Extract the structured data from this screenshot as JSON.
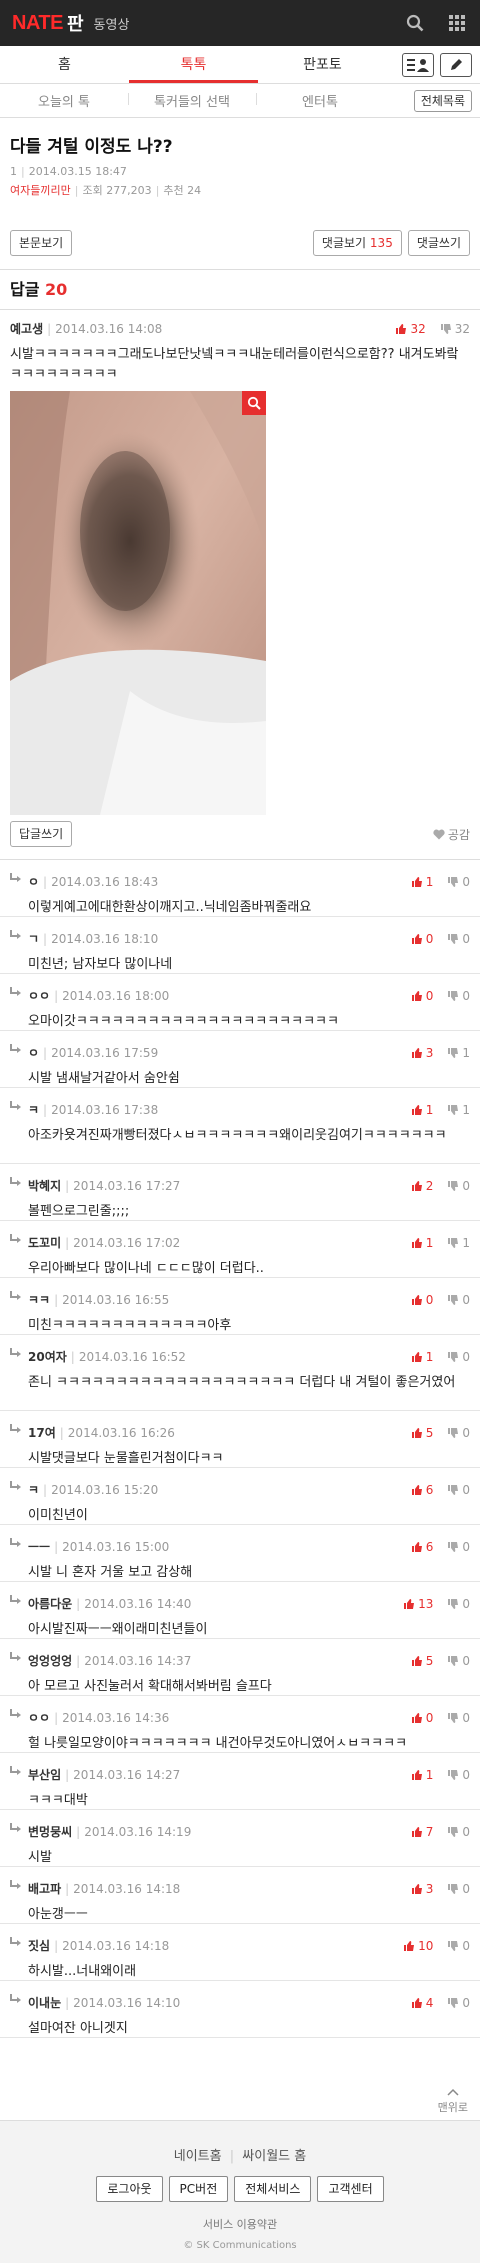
{
  "header": {
    "logo_nate": "NATE",
    "logo_pan": "판",
    "video_link": "동영상",
    "icons": [
      "search-icon",
      "grid-menu-icon"
    ]
  },
  "main_tabs": [
    {
      "label": "홈",
      "active": false
    },
    {
      "label": "톡톡",
      "active": true
    },
    {
      "label": "판포토",
      "active": false
    }
  ],
  "sub_tabs": [
    {
      "label": "오늘의 톡"
    },
    {
      "label": "톡커들의 선택"
    },
    {
      "label": "엔터톡"
    }
  ],
  "all_list_label": "전체목록",
  "post": {
    "title": "다들 겨털 이정도 나??",
    "number": "1",
    "date": "2014.03.15 18:47",
    "category": "여자들끼리만",
    "views": "조회 277,203",
    "recommend": "추천 24",
    "view_body_label": "본문보기",
    "view_comments_label": "댓글보기",
    "comments_count": "135",
    "write_comment_label": "댓글쓰기"
  },
  "reply_count": {
    "label": "답글",
    "count": "20"
  },
  "best_comment": {
    "name": "예고생",
    "date": "2014.03.16 14:08",
    "up": "32",
    "down": "32",
    "text": "시발ㅋㅋㅋㅋㅋㅋㅋ그래도나보단낫넼ㅋㅋㅋ내눈테러를이런식으로함?? 내겨도봐랔ㅋㅋㅋㅋㅋㅋㅋㅋㅋ",
    "reply_label": "답글쓰기",
    "like_label": "공감"
  },
  "comments": [
    {
      "name": "ㅇ",
      "date": "2014.03.16 18:43",
      "up": "1",
      "down": "0",
      "text": "이렇게예고에대한환상이깨지고..닉네임좀바꿔줄래요"
    },
    {
      "name": "ㄱ",
      "date": "2014.03.16 18:10",
      "up": "0",
      "down": "0",
      "text": "미친년; 남자보다 많이나네"
    },
    {
      "name": "ㅇㅇ",
      "date": "2014.03.16 18:00",
      "up": "0",
      "down": "0",
      "text": "오마이갓ㅋㅋㅋㅋㅋㅋㅋㅋㅋㅋㅋㅋㅋㅋㅋㅋㅋㅋㅋㅋㅋㅋ"
    },
    {
      "name": "ㅇ",
      "date": "2014.03.16 17:59",
      "up": "3",
      "down": "1",
      "text": "시발 냄새날거같아서 숨안쉼"
    },
    {
      "name": "ㅋ",
      "date": "2014.03.16 17:38",
      "up": "1",
      "down": "1",
      "text": "아조카욧겨진짜개빵터졌다ㅅㅂㅋㅋㅋㅋㅋㅋㅋ왜이리웃김여기ㅋㅋㅋㅋㅋㅋㅋ"
    },
    {
      "name": "박혜지",
      "date": "2014.03.16 17:27",
      "up": "2",
      "down": "0",
      "text": "볼펜으로그린줄;;;;"
    },
    {
      "name": "도꼬미",
      "date": "2014.03.16 17:02",
      "up": "1",
      "down": "1",
      "text": "우리아빠보다 많이나네 ㄷㄷㄷ많이 더럽다.."
    },
    {
      "name": "ㅋㅋ",
      "date": "2014.03.16 16:55",
      "up": "0",
      "down": "0",
      "text": "미친ㅋㅋㅋㅋㅋㅋㅋㅋㅋㅋㅋㅋㅋ아후"
    },
    {
      "name": "20여자",
      "date": "2014.03.16 16:52",
      "up": "1",
      "down": "0",
      "text": "존니 ㅋㅋㅋㅋㅋㅋㅋㅋㅋㅋㅋㅋㅋㅋㅋㅋㅋㅋㅋㅋ 더럽다 내 겨털이 좋은거였어"
    },
    {
      "name": "17여",
      "date": "2014.03.16 16:26",
      "up": "5",
      "down": "0",
      "text": "시발댓글보다 눈물흘린거첨이다ㅋㅋ"
    },
    {
      "name": "ㅋ",
      "date": "2014.03.16 15:20",
      "up": "6",
      "down": "0",
      "text": "이미친년이"
    },
    {
      "name": "ㅡㅡ",
      "date": "2014.03.16 15:00",
      "up": "6",
      "down": "0",
      "text": "시발 니 혼자 거울 보고 감상해"
    },
    {
      "name": "아름다운",
      "date": "2014.03.16 14:40",
      "up": "13",
      "down": "0",
      "text": "아시발진짜ㅡㅡ왜이래미친년들이"
    },
    {
      "name": "엉엉엉엉",
      "date": "2014.03.16 14:37",
      "up": "5",
      "down": "0",
      "text": "아 모르고 사진눌러서 확대해서봐버림 슬프다"
    },
    {
      "name": "ㅇㅇ",
      "date": "2014.03.16 14:36",
      "up": "0",
      "down": "0",
      "text": "헐 나릇일모양이야ㅋㅋㅋㅋㅋㅋㅋ 내건아무것도아니였어ㅅㅂㅋㅋㅋㅋ"
    },
    {
      "name": "부산임",
      "date": "2014.03.16 14:27",
      "up": "1",
      "down": "0",
      "text": "ㅋㅋㅋ대박"
    },
    {
      "name": "변멍뭉씨",
      "date": "2014.03.16 14:19",
      "up": "7",
      "down": "0",
      "text": "시발"
    },
    {
      "name": "배고파",
      "date": "2014.03.16 14:18",
      "up": "3",
      "down": "0",
      "text": "아눈갱ㅡㅡ"
    },
    {
      "name": "짓심",
      "date": "2014.03.16 14:18",
      "up": "10",
      "down": "0",
      "text": "하시발...너내왜이래"
    },
    {
      "name": "이내눈",
      "date": "2014.03.16 14:10",
      "up": "4",
      "down": "0",
      "text": "설마여잔 아니겟지"
    }
  ],
  "to_top_label": "맨위로",
  "footer": {
    "links": [
      "네이트홈",
      "싸이월드 홈"
    ],
    "buttons": [
      "로그아웃",
      "PC버전",
      "전체서비스",
      "고객센터"
    ],
    "small_links": [
      "서비스 이용약관"
    ],
    "copyright": "© SK Communications"
  },
  "colors": {
    "accent": "#e62f2f",
    "topbar": "#262626"
  }
}
